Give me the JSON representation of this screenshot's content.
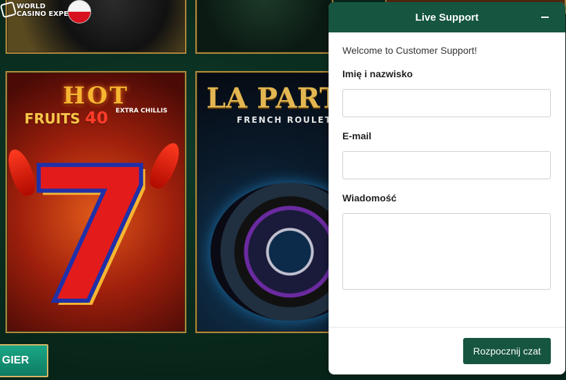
{
  "background": {
    "badge": {
      "line1": "WORLD",
      "line2": "CASINO EXPERT"
    },
    "games": [
      {
        "title": "HOT",
        "subtitle": "FRUITS",
        "number": "40",
        "extra": "EXTRA CHILLIS"
      },
      {
        "title": "LA PARTAG",
        "subtitle": "FRENCH ROULETT"
      }
    ],
    "all_games_button": "J GIER"
  },
  "chat": {
    "title": "Live Support",
    "welcome": "Welcome to Customer Support!",
    "fields": {
      "name_label": "Imię i nazwisko",
      "name_value": "",
      "email_label": "E-mail",
      "email_value": "",
      "message_label": "Wiadomość",
      "message_value": ""
    },
    "start_button": "Rozpocznij czat",
    "colors": {
      "header": "#16553f",
      "button": "#16553f"
    }
  }
}
